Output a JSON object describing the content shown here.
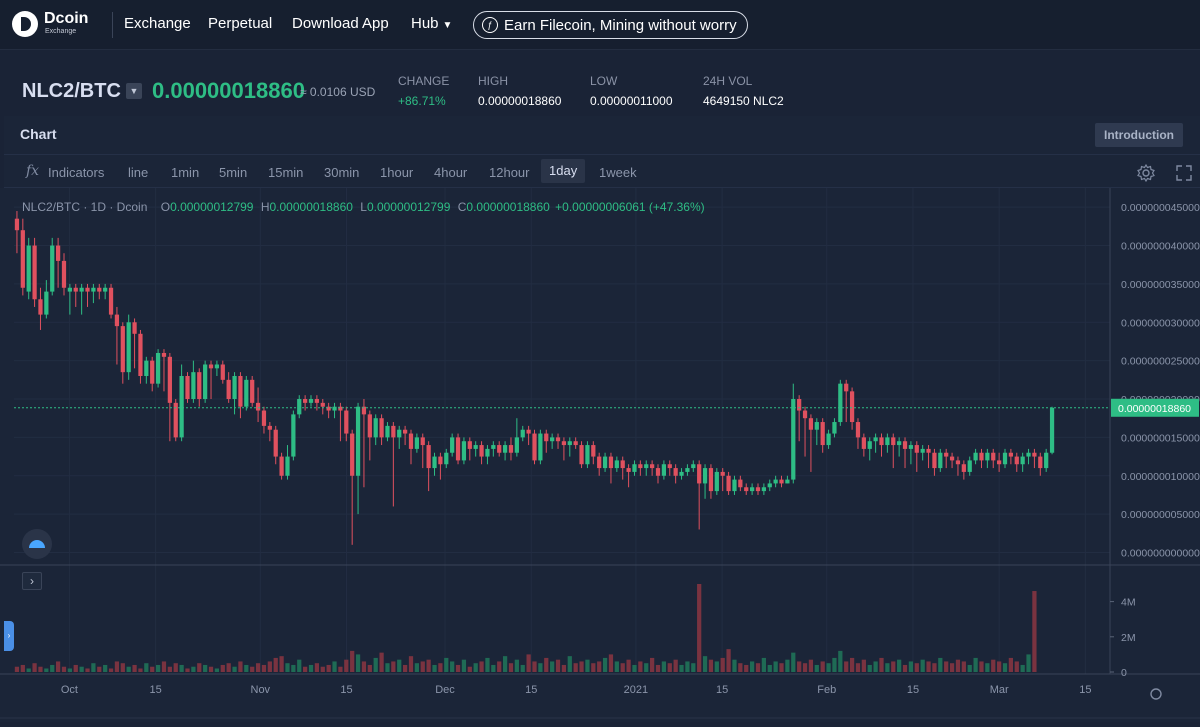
{
  "brand": {
    "name": "Dcoin",
    "sub": "Exchange"
  },
  "nav": {
    "items": [
      "Exchange",
      "Perpetual",
      "Download App",
      "Hub"
    ],
    "earn_label": "Earn Filecoin, Mining without worry"
  },
  "ticker": {
    "pair": "NLC2/BTC",
    "last_price": "0.00000018860",
    "usd_price": "≈ 0.0106 USD",
    "stats": [
      {
        "label": "CHANGE",
        "value": "+86.71%"
      },
      {
        "label": "HIGH",
        "value": "0.00000018860"
      },
      {
        "label": "LOW",
        "value": "0.00000011000"
      },
      {
        "label": "24H VOL",
        "value": "4649150 NLC2"
      }
    ]
  },
  "panel": {
    "title": "Chart",
    "intro_label": "Introduction"
  },
  "toolbar": {
    "indicators_label": "Indicators",
    "intervals": [
      "line",
      "1min",
      "5min",
      "15min",
      "30min",
      "1hour",
      "4hour",
      "12hour",
      "1day",
      "1week"
    ],
    "active_interval": "1day"
  },
  "legend": {
    "symbol": "NLC2/BTC · 1D · Dcoin",
    "o_key": "O",
    "o_val": "0.00000012799",
    "h_key": "H",
    "h_val": "0.00000018860",
    "l_key": "L",
    "l_val": "0.00000012799",
    "c_key": "C",
    "c_val": "0.00000018860",
    "change": "+0.00000006061 (+47.36%)"
  },
  "colors": {
    "up": "#2ebd85",
    "down": "#e0515f",
    "bg": "#1b2538",
    "grid": "#222d42"
  },
  "chart_data": {
    "type": "candlestick",
    "series_note": "",
    "y_ticks": [
      "0.000000045000",
      "0.000000040000",
      "0.000000035000",
      "0.000000030000",
      "0.000000025000",
      "0.000000020000",
      "0.000000015000",
      "0.000000010000",
      "0.000000005000",
      "0.000000000000"
    ],
    "y_tick_values": [
      45,
      40,
      35,
      30,
      25,
      20,
      15,
      10,
      5,
      0
    ],
    "y_unit_scale": "1e-9 BTC",
    "ylim": [
      -1.5,
      47.5
    ],
    "last_price_label": "0.00000018860",
    "last_price_value": 18.86,
    "volume_ticks": [
      "4M",
      "2M",
      "0"
    ],
    "volume_tick_values": [
      4,
      2,
      0
    ],
    "volume_ylim": [
      0,
      5
    ],
    "x_ticks": [
      "Oct",
      "15",
      "Nov",
      "15",
      "Dec",
      "15",
      "2021",
      "15",
      "Feb",
      "15",
      "Mar",
      "15"
    ],
    "x_tick_dates": [
      "2020-10-01",
      "2020-10-15",
      "2020-11-01",
      "2020-11-15",
      "2020-12-01",
      "2020-12-15",
      "2021-01-01",
      "2021-01-15",
      "2021-02-01",
      "2021-02-15",
      "2021-03-01",
      "2021-03-15"
    ],
    "x_range": [
      "2020-09-22",
      "2021-03-19"
    ],
    "candles": [
      [
        43.5,
        42.0,
        44.5,
        39.0
      ],
      [
        42.0,
        34.5,
        43.5,
        33.5
      ],
      [
        34.0,
        40.0,
        41.0,
        33.0
      ],
      [
        40.0,
        33.0,
        41.0,
        32.0
      ],
      [
        33.0,
        31.0,
        34.5,
        29.0
      ],
      [
        31.0,
        34.0,
        35.5,
        30.5
      ],
      [
        34.0,
        40.0,
        41.0,
        33.5
      ],
      [
        40.0,
        38.0,
        41.0,
        34.5
      ],
      [
        38.0,
        34.5,
        39.0,
        33.5
      ],
      [
        34.0,
        34.5,
        35.0,
        31.0
      ],
      [
        34.5,
        34.0,
        35.0,
        32.0
      ],
      [
        34.0,
        34.5,
        35.0,
        31.0
      ],
      [
        34.5,
        34.0,
        35.0,
        32.0
      ],
      [
        34.0,
        34.5,
        35.0,
        32.5
      ],
      [
        34.5,
        34.0,
        35.0,
        33.0
      ],
      [
        34.0,
        34.5,
        35.0,
        33.0
      ],
      [
        34.5,
        31.0,
        35.0,
        30.5
      ],
      [
        31.0,
        29.5,
        32.0,
        24.5
      ],
      [
        29.5,
        23.5,
        30.0,
        22.0
      ],
      [
        23.5,
        30.0,
        31.0,
        22.5
      ],
      [
        30.0,
        28.5,
        30.5,
        24.0
      ],
      [
        28.5,
        23.0,
        29.0,
        22.0
      ],
      [
        23.0,
        25.0,
        25.5,
        22.0
      ],
      [
        25.0,
        22.0,
        25.5,
        21.0
      ],
      [
        22.0,
        26.0,
        26.5,
        21.5
      ],
      [
        26.0,
        25.5,
        26.5,
        21.0
      ],
      [
        25.5,
        19.5,
        26.0,
        14.5
      ],
      [
        19.5,
        15.0,
        20.0,
        14.5
      ],
      [
        15.0,
        23.0,
        24.5,
        14.5
      ],
      [
        23.0,
        20.0,
        23.5,
        19.5
      ],
      [
        20.0,
        23.5,
        25.0,
        19.5
      ],
      [
        23.5,
        20.0,
        24.0,
        19.0
      ],
      [
        20.0,
        24.5,
        25.0,
        19.5
      ],
      [
        24.5,
        24.0,
        25.0,
        20.0
      ],
      [
        24.0,
        24.5,
        25.0,
        23.0
      ],
      [
        24.5,
        22.5,
        25.0,
        22.0
      ],
      [
        22.5,
        20.0,
        23.5,
        19.5
      ],
      [
        20.0,
        23.0,
        23.5,
        18.0
      ],
      [
        23.0,
        19.0,
        23.5,
        17.5
      ],
      [
        19.0,
        22.5,
        23.0,
        18.5
      ],
      [
        22.5,
        19.5,
        23.0,
        19.0
      ],
      [
        19.5,
        18.5,
        21.5,
        17.0
      ],
      [
        18.5,
        16.5,
        19.0,
        15.5
      ],
      [
        16.5,
        16.0,
        17.0,
        14.5
      ],
      [
        16.0,
        12.5,
        16.5,
        11.5
      ],
      [
        12.5,
        10.0,
        13.0,
        9.5
      ],
      [
        10.0,
        12.5,
        14.0,
        9.5
      ],
      [
        12.5,
        18.0,
        18.5,
        12.0
      ],
      [
        18.0,
        20.0,
        20.5,
        17.5
      ],
      [
        20.0,
        19.5,
        20.5,
        18.5
      ],
      [
        19.5,
        20.0,
        20.5,
        19.0
      ],
      [
        20.0,
        19.5,
        20.5,
        18.5
      ],
      [
        19.5,
        19.0,
        20.0,
        18.0
      ],
      [
        19.0,
        18.5,
        19.5,
        17.5
      ],
      [
        18.5,
        19.0,
        19.5,
        17.5
      ],
      [
        19.0,
        18.5,
        19.5,
        14.5
      ],
      [
        18.5,
        15.5,
        19.0,
        14.5
      ],
      [
        15.5,
        10.0,
        16.0,
        1.0
      ],
      [
        10.0,
        19.0,
        19.5,
        5.0
      ],
      [
        19.0,
        18.0,
        20.0,
        8.5
      ],
      [
        18.0,
        15.0,
        18.5,
        12.0
      ],
      [
        15.0,
        17.5,
        18.0,
        14.0
      ],
      [
        17.5,
        15.0,
        18.0,
        14.0
      ],
      [
        15.0,
        16.5,
        17.0,
        14.5
      ],
      [
        16.5,
        15.0,
        17.0,
        6.0
      ],
      [
        15.0,
        16.0,
        16.5,
        13.5
      ],
      [
        16.0,
        15.5,
        16.5,
        14.0
      ],
      [
        15.5,
        13.5,
        16.0,
        11.5
      ],
      [
        13.5,
        15.0,
        15.5,
        13.0
      ],
      [
        15.0,
        14.0,
        15.5,
        11.0
      ],
      [
        14.0,
        11.0,
        14.5,
        8.0
      ],
      [
        11.0,
        12.5,
        13.0,
        10.0
      ],
      [
        12.5,
        11.5,
        13.0,
        9.5
      ],
      [
        11.5,
        13.0,
        13.5,
        11.0
      ],
      [
        13.0,
        15.0,
        15.5,
        12.5
      ],
      [
        15.0,
        12.0,
        15.5,
        11.5
      ],
      [
        12.0,
        14.5,
        15.0,
        11.5
      ],
      [
        14.5,
        13.5,
        15.0,
        12.0
      ],
      [
        13.5,
        14.0,
        14.5,
        12.5
      ],
      [
        14.0,
        12.5,
        14.5,
        11.5
      ],
      [
        12.5,
        13.5,
        14.0,
        11.5
      ],
      [
        13.5,
        14.0,
        14.5,
        12.5
      ],
      [
        14.0,
        13.0,
        14.5,
        12.5
      ],
      [
        13.0,
        14.0,
        14.5,
        12.0
      ],
      [
        14.0,
        13.0,
        15.0,
        12.0
      ],
      [
        13.0,
        15.0,
        17.5,
        12.5
      ],
      [
        15.0,
        16.0,
        16.5,
        14.5
      ],
      [
        16.0,
        15.5,
        16.5,
        14.0
      ],
      [
        15.5,
        12.0,
        16.0,
        11.5
      ],
      [
        12.0,
        15.5,
        16.0,
        11.5
      ],
      [
        15.5,
        14.5,
        16.0,
        13.0
      ],
      [
        14.5,
        15.0,
        15.5,
        13.5
      ],
      [
        15.0,
        14.5,
        15.5,
        13.5
      ],
      [
        14.5,
        14.0,
        15.0,
        12.0
      ],
      [
        14.0,
        14.5,
        15.0,
        12.5
      ],
      [
        14.5,
        14.0,
        15.0,
        13.5
      ],
      [
        14.0,
        11.5,
        14.5,
        11.0
      ],
      [
        11.5,
        14.0,
        14.5,
        11.0
      ],
      [
        14.0,
        12.5,
        14.5,
        11.5
      ],
      [
        12.5,
        11.0,
        13.0,
        10.0
      ],
      [
        11.0,
        12.5,
        13.0,
        10.5
      ],
      [
        12.5,
        11.0,
        13.0,
        9.0
      ],
      [
        11.0,
        12.0,
        12.5,
        10.5
      ],
      [
        12.0,
        11.0,
        12.5,
        9.5
      ],
      [
        11.0,
        10.5,
        11.5,
        8.5
      ],
      [
        10.5,
        11.5,
        12.0,
        10.0
      ],
      [
        11.5,
        11.0,
        12.0,
        10.0
      ],
      [
        11.0,
        11.5,
        12.0,
        10.0
      ],
      [
        11.5,
        11.0,
        12.0,
        10.0
      ],
      [
        11.0,
        10.0,
        11.5,
        9.0
      ],
      [
        10.0,
        11.5,
        12.0,
        9.5
      ],
      [
        11.5,
        11.0,
        12.0,
        10.0
      ],
      [
        11.0,
        10.0,
        11.5,
        9.0
      ],
      [
        10.0,
        10.5,
        11.0,
        9.5
      ],
      [
        10.5,
        11.0,
        11.5,
        10.0
      ],
      [
        11.0,
        11.5,
        12.0,
        10.5
      ],
      [
        11.5,
        9.0,
        12.0,
        3.0
      ],
      [
        9.0,
        11.0,
        11.5,
        7.0
      ],
      [
        11.0,
        8.0,
        11.5,
        7.0
      ],
      [
        8.0,
        10.5,
        11.0,
        7.5
      ],
      [
        10.5,
        10.0,
        11.0,
        8.0
      ],
      [
        10.0,
        8.0,
        10.5,
        7.5
      ],
      [
        8.0,
        9.5,
        10.0,
        7.5
      ],
      [
        9.5,
        8.5,
        10.0,
        8.0
      ],
      [
        8.5,
        8.0,
        9.0,
        7.5
      ],
      [
        8.0,
        8.5,
        9.0,
        7.5
      ],
      [
        8.5,
        8.0,
        9.0,
        7.5
      ],
      [
        8.0,
        8.5,
        9.0,
        7.5
      ],
      [
        8.5,
        9.0,
        9.5,
        8.0
      ],
      [
        9.0,
        9.5,
        10.0,
        8.5
      ],
      [
        9.5,
        9.0,
        10.0,
        8.5
      ],
      [
        9.0,
        9.5,
        10.0,
        9.0
      ],
      [
        9.5,
        20.0,
        22.0,
        9.0
      ],
      [
        20.0,
        18.5,
        20.5,
        14.5
      ],
      [
        18.5,
        17.5,
        19.0,
        12.5
      ],
      [
        17.5,
        16.0,
        18.0,
        10.5
      ],
      [
        16.0,
        17.0,
        17.5,
        14.0
      ],
      [
        17.0,
        14.0,
        17.5,
        13.0
      ],
      [
        14.0,
        15.5,
        16.0,
        13.5
      ],
      [
        15.5,
        17.0,
        17.5,
        15.0
      ],
      [
        17.0,
        22.0,
        22.5,
        16.5
      ],
      [
        22.0,
        21.0,
        22.5,
        17.0
      ],
      [
        21.0,
        17.0,
        21.5,
        16.0
      ],
      [
        17.0,
        15.0,
        17.5,
        13.5
      ],
      [
        15.0,
        13.5,
        15.5,
        12.5
      ],
      [
        13.5,
        14.5,
        15.0,
        12.0
      ],
      [
        14.5,
        15.0,
        15.5,
        13.0
      ],
      [
        15.0,
        14.0,
        15.5,
        12.5
      ],
      [
        14.0,
        15.0,
        15.5,
        13.0
      ],
      [
        15.0,
        14.0,
        15.5,
        11.0
      ],
      [
        14.0,
        14.5,
        15.0,
        12.5
      ],
      [
        14.5,
        13.5,
        15.0,
        11.0
      ],
      [
        13.5,
        14.0,
        14.5,
        11.5
      ],
      [
        14.0,
        13.0,
        14.5,
        10.5
      ],
      [
        13.0,
        13.5,
        14.0,
        12.0
      ],
      [
        13.5,
        13.0,
        14.0,
        11.0
      ],
      [
        13.0,
        11.0,
        13.5,
        10.0
      ],
      [
        11.0,
        13.0,
        13.5,
        10.5
      ],
      [
        13.0,
        12.5,
        13.5,
        11.0
      ],
      [
        12.5,
        12.0,
        13.0,
        11.0
      ],
      [
        12.0,
        11.5,
        12.5,
        10.0
      ],
      [
        11.5,
        10.5,
        12.0,
        9.5
      ],
      [
        10.5,
        12.0,
        12.5,
        10.0
      ],
      [
        12.0,
        13.0,
        13.5,
        11.5
      ],
      [
        13.0,
        12.0,
        13.5,
        11.0
      ],
      [
        12.0,
        13.0,
        13.5,
        11.0
      ],
      [
        13.0,
        12.0,
        13.5,
        11.0
      ],
      [
        12.0,
        11.5,
        13.0,
        10.5
      ],
      [
        11.5,
        13.0,
        13.5,
        11.0
      ],
      [
        13.0,
        12.5,
        13.5,
        11.5
      ],
      [
        12.5,
        11.5,
        13.0,
        10.5
      ],
      [
        11.5,
        12.5,
        13.0,
        10.5
      ],
      [
        12.5,
        13.0,
        13.5,
        11.5
      ],
      [
        13.0,
        12.5,
        13.5,
        11.0
      ],
      [
        12.5,
        11.0,
        13.0,
        10.0
      ],
      [
        11.0,
        13.0,
        13.5,
        10.5
      ],
      [
        13.0,
        18.86,
        19.0,
        12.8
      ]
    ],
    "volume": [
      0.3,
      0.4,
      0.2,
      0.5,
      0.3,
      0.2,
      0.4,
      0.6,
      0.3,
      0.2,
      0.4,
      0.3,
      0.2,
      0.5,
      0.3,
      0.4,
      0.2,
      0.6,
      0.5,
      0.3,
      0.4,
      0.2,
      0.5,
      0.3,
      0.4,
      0.6,
      0.3,
      0.5,
      0.4,
      0.2,
      0.3,
      0.5,
      0.4,
      0.3,
      0.2,
      0.4,
      0.5,
      0.3,
      0.6,
      0.4,
      0.3,
      0.5,
      0.4,
      0.6,
      0.8,
      0.9,
      0.5,
      0.4,
      0.7,
      0.3,
      0.4,
      0.5,
      0.3,
      0.4,
      0.6,
      0.3,
      0.7,
      1.2,
      1.0,
      0.6,
      0.4,
      0.8,
      1.1,
      0.5,
      0.6,
      0.7,
      0.4,
      0.9,
      0.5,
      0.6,
      0.7,
      0.4,
      0.5,
      0.8,
      0.6,
      0.4,
      0.7,
      0.3,
      0.5,
      0.6,
      0.8,
      0.4,
      0.6,
      0.9,
      0.5,
      0.7,
      0.4,
      1.0,
      0.6,
      0.5,
      0.8,
      0.6,
      0.7,
      0.4,
      0.9,
      0.5,
      0.6,
      0.7,
      0.5,
      0.6,
      0.8,
      1.0,
      0.6,
      0.5,
      0.7,
      0.4,
      0.6,
      0.5,
      0.8,
      0.4,
      0.6,
      0.5,
      0.7,
      0.4,
      0.6,
      0.5,
      5.0,
      0.9,
      0.7,
      0.6,
      0.8,
      1.3,
      0.7,
      0.5,
      0.4,
      0.6,
      0.5,
      0.8,
      0.4,
      0.6,
      0.5,
      0.7,
      1.1,
      0.6,
      0.5,
      0.7,
      0.4,
      0.6,
      0.5,
      0.8,
      1.2,
      0.6,
      0.8,
      0.5,
      0.7,
      0.4,
      0.6,
      0.8,
      0.5,
      0.6,
      0.7,
      0.4,
      0.6,
      0.5,
      0.7,
      0.6,
      0.5,
      0.8,
      0.6,
      0.5,
      0.7,
      0.6,
      0.4,
      0.8,
      0.6,
      0.5,
      0.7,
      0.6,
      0.5,
      0.8,
      0.6,
      0.4,
      1.0,
      4.6
    ]
  }
}
